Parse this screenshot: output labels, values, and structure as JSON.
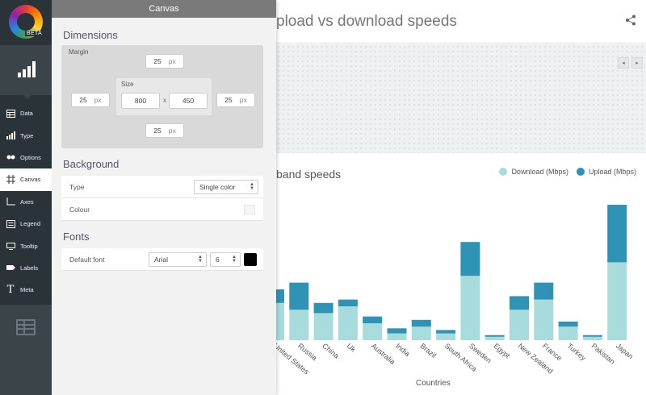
{
  "nav": {
    "beta": "BETA",
    "items": [
      {
        "label": "Data",
        "icon": "table-icon"
      },
      {
        "label": "Type",
        "icon": "bar-chart-icon"
      },
      {
        "label": "Options",
        "icon": "options-icon"
      },
      {
        "label": "Canvas",
        "icon": "canvas-icon"
      },
      {
        "label": "Axes",
        "icon": "axes-icon"
      },
      {
        "label": "Legend",
        "icon": "legend-icon"
      },
      {
        "label": "Tooltip",
        "icon": "tooltip-icon"
      },
      {
        "label": "Labels",
        "icon": "labels-icon"
      },
      {
        "label": "Meta",
        "icon": "text-icon"
      }
    ],
    "active_index": 3
  },
  "panel": {
    "header": "Canvas",
    "dimensions": {
      "title": "Dimensions",
      "margin_label": "Margin",
      "margin_top": "25",
      "margin_left": "25",
      "margin_right": "25",
      "margin_bottom": "25",
      "unit": "px",
      "size_label": "Size",
      "width": "800",
      "times": "x",
      "height": "450"
    },
    "background": {
      "title": "Background",
      "type_label": "Type",
      "type_value": "Single color",
      "colour_label": "Colour",
      "colour_value": "#f5f5f5"
    },
    "fonts": {
      "title": "Fonts",
      "default_label": "Default font",
      "font_value": "Arial",
      "size_value": "6",
      "color_value": "#000000"
    }
  },
  "main": {
    "title": "pload vs download speeds",
    "subtitle": "band speeds",
    "xlabel": "Countries"
  },
  "chart_data": {
    "type": "bar",
    "stacked": true,
    "categories": [
      "United States",
      "Russia",
      "China",
      "Uk",
      "Australia",
      "India",
      "Brazil",
      "South Africa",
      "Sweden",
      "Egypt",
      "New Zealand",
      "France",
      "Turkey",
      "Pakistan",
      "Japan"
    ],
    "series": [
      {
        "name": "Download (Mbps)",
        "color": "#a8dcdc",
        "values": [
          11,
          9,
          8,
          10,
          5,
          2,
          4,
          2,
          19,
          1,
          9,
          12,
          4,
          1,
          23
        ]
      },
      {
        "name": "Upload (Mbps)",
        "color": "#2e93b5",
        "values": [
          4,
          8,
          3,
          2,
          2,
          1.5,
          2,
          1,
          10,
          0.5,
          4,
          5,
          1.5,
          0.5,
          17
        ]
      }
    ],
    "xlabel": "Countries",
    "legend_position": "top-right"
  }
}
